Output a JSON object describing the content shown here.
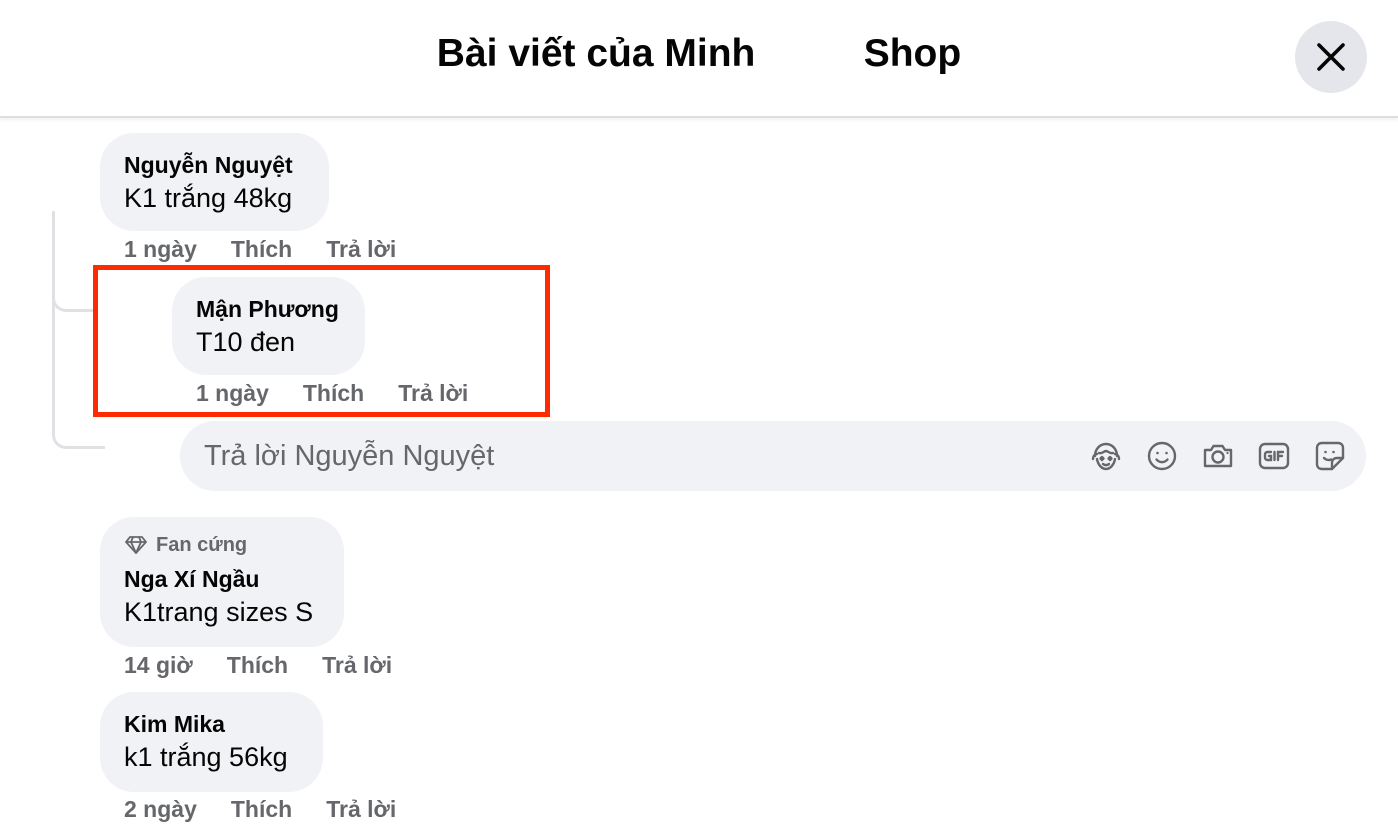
{
  "header": {
    "title": "Bài viết của Minh          Shop",
    "close_icon": "close-icon"
  },
  "comments": [
    {
      "author": "Nguyễn Nguyệt",
      "text": "K1 trắng 48kg",
      "time": "1 ngày",
      "like": "Thích",
      "reply": "Trả lời"
    },
    {
      "author": "Mận Phương",
      "text": "T10 đen",
      "time": "1 ngày",
      "like": "Thích",
      "reply": "Trả lời"
    },
    {
      "badge": "Fan cứng",
      "badge_icon": "diamond-icon",
      "author": "Nga Xí Ngầu",
      "text": "K1trang sizes S",
      "time": "14 giờ",
      "like": "Thích",
      "reply": "Trả lời"
    },
    {
      "author": "Kim Mika",
      "text": "k1 trắng 56kg",
      "time": "2 ngày",
      "like": "Thích",
      "reply": "Trả lời"
    }
  ],
  "reply_box": {
    "placeholder": "Trả lời Nguyễn Nguyệt",
    "icons": [
      "avatar-sticker-icon",
      "emoji-icon",
      "camera-icon",
      "gif-icon",
      "sticker-icon"
    ]
  },
  "colors": {
    "highlight": "#ff2a00",
    "bubble": "#f0f2f5",
    "secondary_text": "#65676b"
  }
}
